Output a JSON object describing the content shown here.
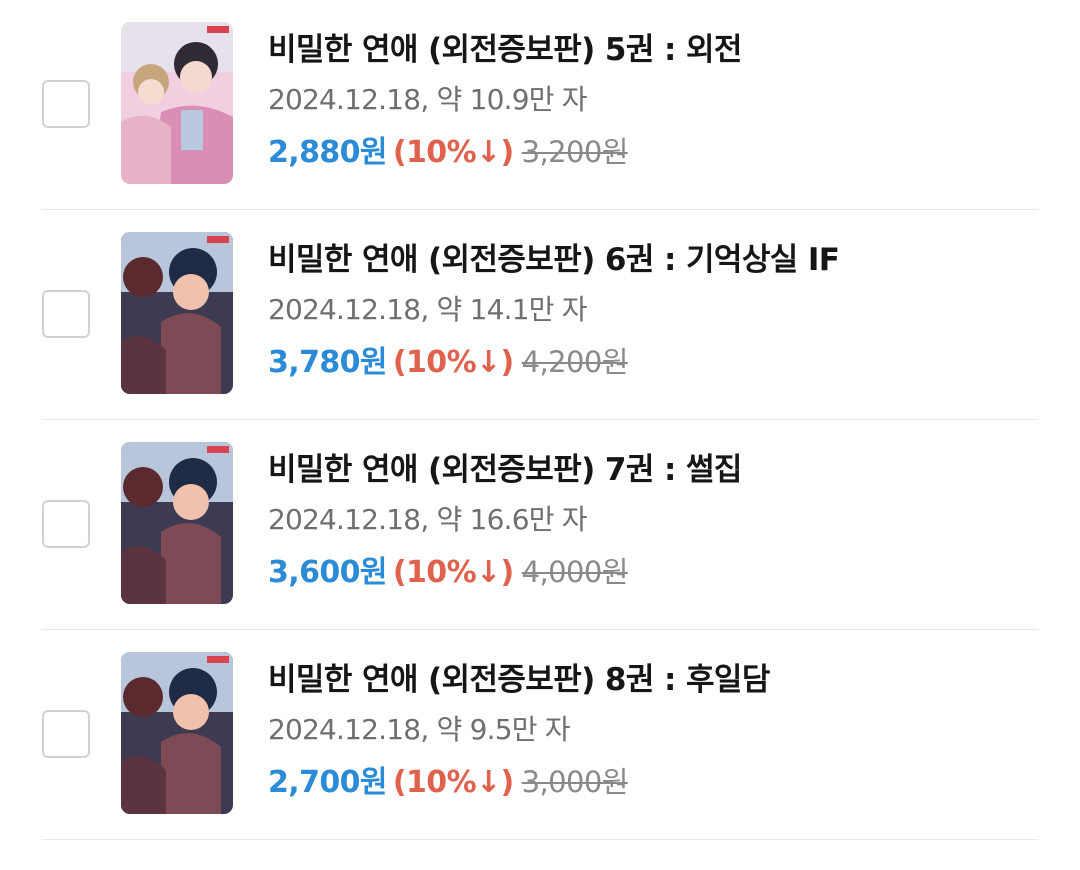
{
  "items": [
    {
      "title": "비밀한 연애 (외전증보판) 5권 : 외전",
      "date": "2024.12.18,",
      "length": "약 10.9만 자",
      "price": "2,880원",
      "discount": "(10%↓)",
      "original_price": "3,200원",
      "cover_palette": [
        "#f3c9d8",
        "#d98fb3",
        "#8f6a7d",
        "#e6e1ea"
      ]
    },
    {
      "title": "비밀한 연애 (외전증보판) 6권 : 기억상실 IF",
      "date": "2024.12.18,",
      "length": "약 14.1만 자",
      "price": "3,780원",
      "discount": "(10%↓)",
      "original_price": "4,200원",
      "cover_palette": [
        "#3a3b56",
        "#7d4a55",
        "#e8b7a4",
        "#b8c6dc"
      ]
    },
    {
      "title": "비밀한 연애 (외전증보판) 7권 : 썰집",
      "date": "2024.12.18,",
      "length": "약 16.6만 자",
      "price": "3,600원",
      "discount": "(10%↓)",
      "original_price": "4,000원",
      "cover_palette": [
        "#3a3b56",
        "#7d4a55",
        "#e8b7a4",
        "#b8c6dc"
      ]
    },
    {
      "title": "비밀한 연애 (외전증보판) 8권 : 후일담",
      "date": "2024.12.18,",
      "length": "약 9.5만 자",
      "price": "2,700원",
      "discount": "(10%↓)",
      "original_price": "3,000원",
      "cover_palette": [
        "#3a3b56",
        "#7d4a55",
        "#e8b7a4",
        "#b8c6dc"
      ]
    }
  ],
  "colors": {
    "price": "#2b8bd6",
    "discount": "#e0624d",
    "original_price": "#8a8a8a",
    "title": "#161616",
    "meta": "#6f6f6f"
  }
}
